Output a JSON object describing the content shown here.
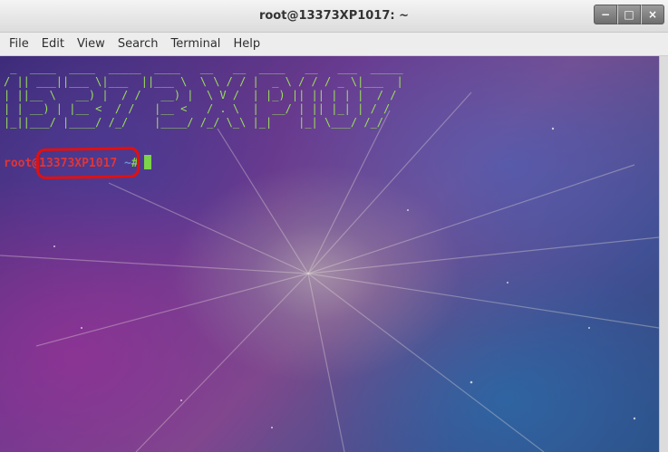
{
  "window": {
    "title": "root@13373XP1017: ~",
    "controls": {
      "minimize_symbol": "−",
      "maximize_symbol": "□",
      "close_symbol": "×"
    }
  },
  "menubar": {
    "items": [
      "File",
      "Edit",
      "View",
      "Search",
      "Terminal",
      "Help"
    ]
  },
  "terminal": {
    "banner_lines": [
      " _  ____  ____  _____  ____   __   __  ____   __   ___  _____ ",
      "/ || ___||___ \\|___  ||___ \\  \\ \\ / / |  _ \\ / / / _ \\|___  |",
      "| ||__ \\   __) |  / /   __) |  \\ V /  | |_) || || | | |  / / ",
      "| | __) | |__ <  / /   |__ <   / . \\  |  __/ | || |_| | / /  ",
      "|_||___/ |____/ /_/    |____/ /_/ \\_\\ |_|    |_| \\___/ /_/   "
    ],
    "prompt": {
      "user": "root",
      "at": "@",
      "host": "13373XP1017",
      "path": " ~",
      "symbol": "#"
    },
    "colors": {
      "banner": "#9ae05a",
      "prompt_user": "#e03535",
      "prompt_path": "#6b8ed6",
      "prompt_symbol": "#7bd34a",
      "highlight": "#e01010"
    }
  }
}
